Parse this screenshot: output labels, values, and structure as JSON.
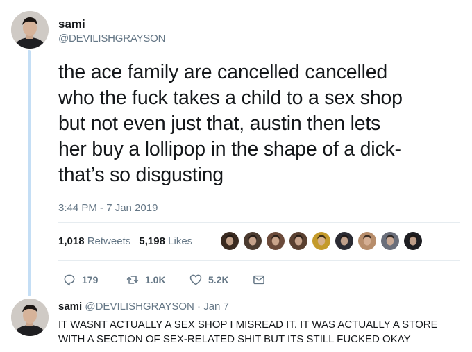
{
  "tweet": {
    "display_name": "sami",
    "handle": "@DEVILISHGRAYSON",
    "text_lines": [
      "the ace family are cancelled cancelled",
      "who the fuck takes a child to a sex shop",
      "but not even just that, austin then lets",
      "her buy a lollipop in the shape of a dick-",
      "that’s so disgusting"
    ],
    "timestamp": "3:44 PM - 7 Jan 2019",
    "retweet_count": "1,018",
    "retweet_label": "Retweets",
    "like_count": "5,198",
    "like_label": "Likes",
    "actions": {
      "reply_count": "179",
      "retweet_count": "1.0K",
      "like_count": "5.2K"
    },
    "liker_avatar_colors": [
      "#3a2a20",
      "#4b3b30",
      "#6b4a3a",
      "#5a4030",
      "#c49a2a",
      "#2b2b33",
      "#b78d6b",
      "#6a6e7a",
      "#1e1e22"
    ]
  },
  "reply": {
    "display_name": "sami",
    "handle": "@DEVILISHGRAYSON",
    "separator": "·",
    "date": "Jan 7",
    "text_lines": [
      "IT WASNT ACTUALLY A SEX SHOP I MISREAD IT. IT WAS ACTUALLY A STORE",
      "WITH A SECTION OF SEX-RELATED SHIT BUT ITS STILL FUCKED OKAY"
    ]
  },
  "colors": {
    "text": "#14171a",
    "muted": "#657786",
    "thread_line": "#c4def5",
    "divider": "#e6ecf0"
  }
}
